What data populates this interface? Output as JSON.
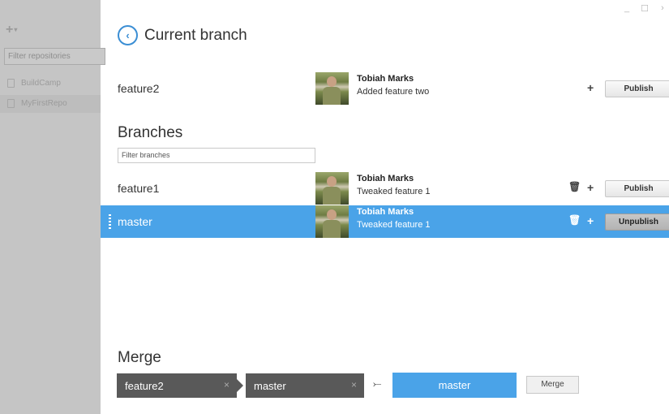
{
  "sidebar": {
    "add_icon": "+",
    "filter_placeholder": "Filter repositories",
    "repos": [
      {
        "name": "BuildCamp"
      },
      {
        "name": "MyFirstRepo"
      }
    ]
  },
  "window_controls": {
    "minimize": "_",
    "maximize": "☐",
    "close": "›"
  },
  "header": {
    "back_icon": "‹",
    "title": "Current branch"
  },
  "current_branch": {
    "name": "feature2",
    "author": "Tobiah Marks",
    "message": "Added feature two",
    "plus_icon": "+",
    "publish_label": "Publish"
  },
  "branches": {
    "heading": "Branches",
    "filter_placeholder": "Filter branches",
    "items": [
      {
        "name": "feature1",
        "author": "Tobiah Marks",
        "message": "Tweaked feature 1",
        "trash_icon": "🗑",
        "plus_icon": "+",
        "action_label": "Publish"
      },
      {
        "name": "master",
        "author": "Tobiah Marks",
        "message": "Tweaked feature 1",
        "trash_icon": "🗑",
        "plus_icon": "+",
        "action_label": "Unpublish"
      }
    ]
  },
  "merge": {
    "heading": "Merge",
    "source_a": "feature2",
    "source_b": "master",
    "remove_icon": "×",
    "arrow_icon": "⤚",
    "target": "master",
    "button_label": "Merge"
  },
  "colors": {
    "accent": "#4aa3e8",
    "chip": "#595959",
    "sidebar": "#c5c5c5"
  }
}
